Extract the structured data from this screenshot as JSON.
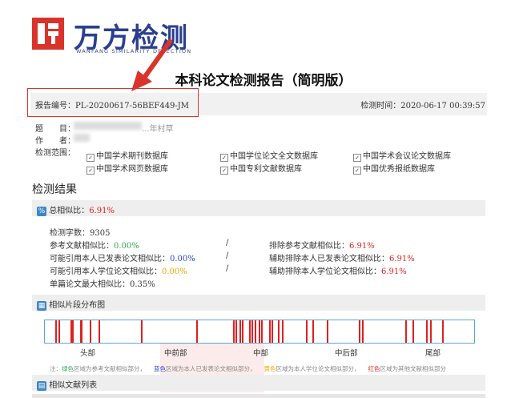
{
  "logo": {
    "text": "万方检测",
    "subtitle": "WANFANG SIMILARITY DETECTION"
  },
  "report": {
    "title": "本科论文检测报告（简明版）",
    "number": "报告编号：PL-20200617-56BEF449-JM",
    "time": "检测时间：2020-06-17 00:39:57"
  },
  "meta": {
    "topic_label": "题",
    "topic_label2": "目：",
    "topic_tail": "...年村草",
    "author_label": "作",
    "author_label2": "者：",
    "scope_label": "检测范围："
  },
  "databases": [
    "中国学术期刊数据库",
    "中国学位论文全文数据库",
    "中国学术会议论文数据库",
    "中国学术网页数据库",
    "中国专利文献数据库",
    "中国优秀报纸数据库"
  ],
  "results": {
    "heading": "检测结果",
    "total_label": "总相似比：",
    "total_value": "6.91%",
    "word_count": "检测字数：9305",
    "ref_label": "参考文献相似比：",
    "ref_value": "0.00%",
    "excl_ref_label": "排除参考文献相似比：",
    "excl_ref_value": "6.91%",
    "self_pub_label": "可能引用本人已发表论文相似比：",
    "self_pub_value": "0.00%",
    "excl_self_pub_label": "辅助排除本人已发表论文相似比：",
    "excl_self_pub_value": "6.91%",
    "self_thesis_label": "可能引用本人学位论文相似比：",
    "self_thesis_value": "0.00%",
    "excl_self_thesis_label": "辅助排除本人学位论文相似比：",
    "excl_self_thesis_value": "6.91%",
    "max_single": "单篇论文最大相似比：0.35%",
    "slash": "/"
  },
  "distribution": {
    "heading": "相似片段分布图",
    "axis": [
      "头部",
      "中前部",
      "中部",
      "中后部",
      "尾部"
    ]
  },
  "legend": {
    "prefix": "注：",
    "green": "绿色",
    "green_text": "区域为参考文献相似部分，",
    "blue": "蓝色",
    "blue_text": "区域为本人已发表论文相似部分，",
    "yellow": "黄色",
    "yellow_text": "区域为本人学位论文相似部分，",
    "red": "红色",
    "red_text": "区域为其他文献相似部分"
  },
  "list": {
    "heading": "相似文献列表"
  },
  "chart_data": {
    "type": "bar",
    "title": "相似片段分布图",
    "x_range": [
      0,
      1
    ],
    "x_ticks": [
      "头部",
      "中前部",
      "中部",
      "中后部",
      "尾部"
    ],
    "segments": [
      0.025,
      0.032,
      0.06,
      0.063,
      0.082,
      0.085,
      0.105,
      0.125,
      0.225,
      0.354,
      0.44,
      0.445,
      0.455,
      0.46,
      0.478,
      0.484,
      0.49,
      0.5,
      0.506,
      0.525,
      0.53,
      0.545,
      0.555,
      0.61,
      0.625,
      0.66,
      0.735,
      0.742,
      0.842,
      0.86,
      0.892,
      0.9,
      0.928
    ],
    "segment_color": "#e02020"
  }
}
